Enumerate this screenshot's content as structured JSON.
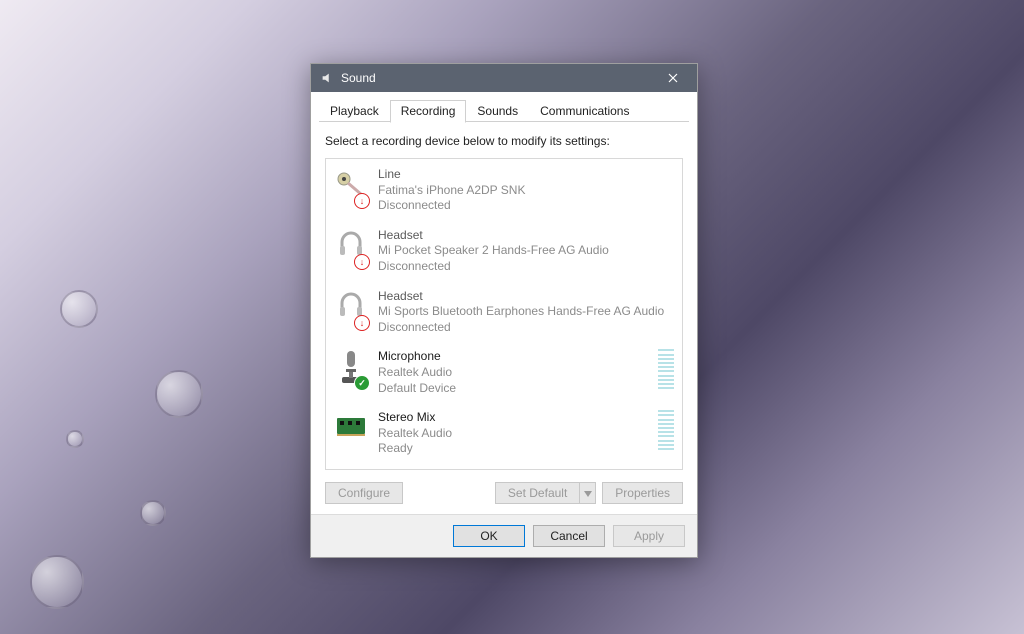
{
  "window": {
    "title": "Sound"
  },
  "tabs": [
    {
      "label": "Playback",
      "active": false
    },
    {
      "label": "Recording",
      "active": true
    },
    {
      "label": "Sounds",
      "active": false
    },
    {
      "label": "Communications",
      "active": false
    }
  ],
  "instruction": "Select a recording device below to modify its settings:",
  "devices": [
    {
      "name": "Line",
      "sub": "Fatima's iPhone A2DP SNK",
      "status": "Disconnected",
      "icon": "line",
      "badge": "red",
      "enabled": false,
      "level": false
    },
    {
      "name": "Headset",
      "sub": "Mi Pocket Speaker 2 Hands-Free AG Audio",
      "status": "Disconnected",
      "icon": "headset",
      "badge": "red",
      "enabled": false,
      "level": false
    },
    {
      "name": "Headset",
      "sub": "Mi Sports Bluetooth Earphones Hands-Free AG Audio",
      "status": "Disconnected",
      "icon": "headset",
      "badge": "red",
      "enabled": false,
      "level": false
    },
    {
      "name": "Microphone",
      "sub": "Realtek Audio",
      "status": "Default Device",
      "icon": "mic",
      "badge": "green",
      "enabled": true,
      "level": true
    },
    {
      "name": "Stereo Mix",
      "sub": "Realtek Audio",
      "status": "Ready",
      "icon": "card",
      "badge": "",
      "enabled": true,
      "level": true
    }
  ],
  "buttons": {
    "configure": "Configure",
    "set_default": "Set Default",
    "properties": "Properties",
    "ok": "OK",
    "cancel": "Cancel",
    "apply": "Apply"
  }
}
